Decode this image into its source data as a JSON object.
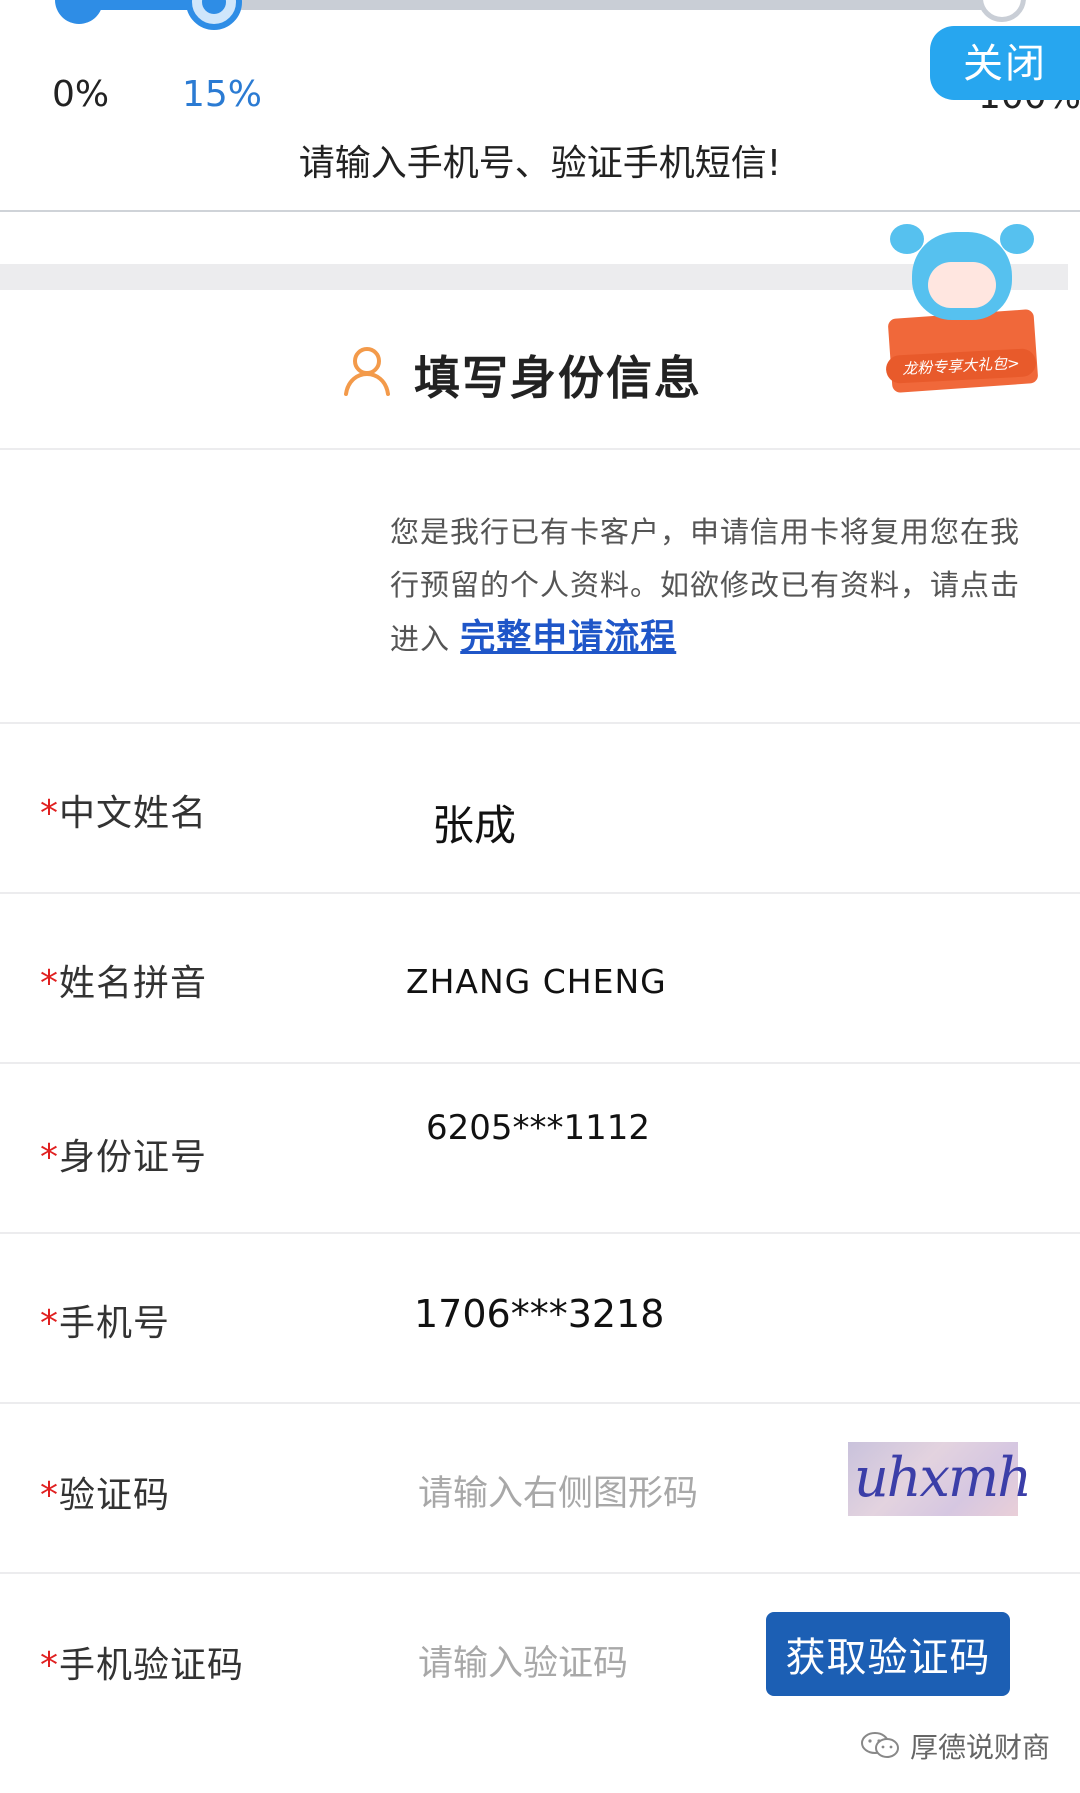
{
  "progress": {
    "value_percent": 15,
    "labels": {
      "start": "0%",
      "current": "15%",
      "end": "100%"
    },
    "step_title": "请输入手机号、验证手机短信!",
    "close_label": "关闭"
  },
  "promo": {
    "label": "龙粉专享大礼包>"
  },
  "section": {
    "title": "填写身份信息",
    "icon": "user-icon"
  },
  "notice": {
    "text": "您是我行已有卡客户，申请信用卡将复用您在我行预留的个人资料。如欲修改已有资料，请点击进入",
    "link": "完整申请流程"
  },
  "form": {
    "required_mark": "*",
    "name_cn": {
      "label": "中文姓名",
      "value": "张成"
    },
    "name_pinyin": {
      "label": "姓名拼音",
      "value": "ZHANG CHENG"
    },
    "id_number": {
      "label": "身份证号",
      "value": "6205***1112"
    },
    "phone": {
      "label": "手机号",
      "value": "1706***3218"
    },
    "captcha": {
      "label": "验证码",
      "placeholder": "请输入右侧图形码",
      "image_text": "uhxmh"
    },
    "sms_code": {
      "label": "手机验证码",
      "placeholder": "请输入验证码",
      "button": "获取验证码"
    }
  },
  "watermark": {
    "text": "厚德说财商",
    "icon": "wechat-icon"
  },
  "colors": {
    "accent": "#2e8de6",
    "close_bg": "#27a6ef",
    "button_bg": "#1c5fb4",
    "required": "#e02020",
    "link": "#1f56c8"
  }
}
